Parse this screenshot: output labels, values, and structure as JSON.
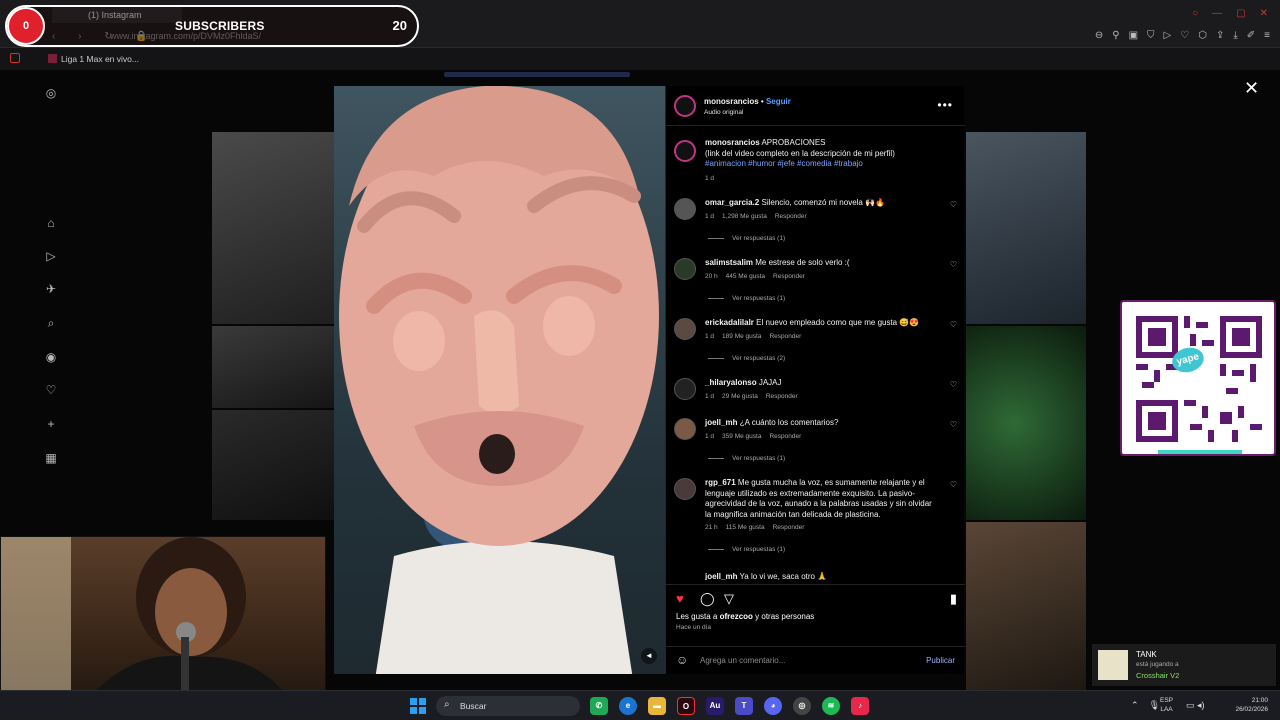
{
  "overlay": {
    "subscriber_label": "SUBSCRIBERS",
    "subscriber_count": "20",
    "circle_count": "0"
  },
  "browser": {
    "tab_title": "(1) Instagram",
    "url": "www.instagram.com/p/DVMz0FhldaS/",
    "bookmark_title": "Liga 1 Max en vivo..."
  },
  "post": {
    "author": "monosrancios",
    "separator": "•",
    "follow_label": "Seguir",
    "audio": "Audio original",
    "caption_title": "APROBACIONES",
    "caption_line2": "(link del video completo en la descripción de mi perfil)",
    "caption_tags": "#animacion #humor #jefe #comedia #trabajo",
    "caption_time": "1 d",
    "likes_text_prefix": "Les gusta a ",
    "likes_user": "ofrezcoo",
    "likes_text_suffix": " y otras personas",
    "posted": "Hace un día",
    "comment_placeholder": "Agrega un comentario...",
    "publish_label": "Publicar"
  },
  "comments": [
    {
      "user": "omar_garcia.2",
      "text": "Silencio, comenzó mi novela 🙌🏻🔥",
      "time": "1 d",
      "likes": "1,298 Me gusta",
      "reply": "Responder",
      "replies": "Ver respuestas (1)"
    },
    {
      "user": "salimstsalim",
      "text": "Me estrese de solo verlo :(",
      "time": "20 h",
      "likes": "445 Me gusta",
      "reply": "Responder",
      "replies": "Ver respuestas (1)"
    },
    {
      "user": "erickadalilalr",
      "text": "El nuevo empleado como que me gusta 😅😍",
      "time": "1 d",
      "likes": "189 Me gusta",
      "reply": "Responder",
      "replies": "Ver respuestas (2)"
    },
    {
      "user": "_hilaryalonso",
      "text": "JAJAJ",
      "time": "1 d",
      "likes": "29 Me gusta",
      "reply": "Responder",
      "replies": ""
    },
    {
      "user": "joell_mh",
      "text": "¿A cuánto los comentarios?",
      "time": "1 d",
      "likes": "359 Me gusta",
      "reply": "Responder",
      "replies": "Ver respuestas (1)"
    },
    {
      "user": "rgp_671",
      "text": "Me gusta mucha la voz, es sumamente relajante y el lenguaje utilizado es extremadamente exquisito. La pasivo-agrecividad de la voz, aunado a la palabras usadas y sin olvidar la magnifica animación tan delicada de plasticina.",
      "time": "21 h",
      "likes": "115 Me gusta",
      "reply": "Responder",
      "replies": "Ver respuestas (1)"
    },
    {
      "user": "joell_mh",
      "text": "Ya lo vi we, saca otro 🙏",
      "time": "",
      "likes": "",
      "reply": "",
      "replies": ""
    }
  ],
  "sidebar_icons": [
    "instagram-icon",
    "home-icon",
    "reels-icon",
    "messages-icon",
    "search-icon",
    "explore-icon",
    "heart-icon",
    "create-icon",
    "dashboard-icon"
  ],
  "qr": {
    "badge": "yape"
  },
  "notification": {
    "name": "TANK",
    "status": "está jugando a",
    "game": "Crosshair V2"
  },
  "taskbar": {
    "search_placeholder": "Buscar",
    "lang_1": "ESP",
    "lang_2": "LAA",
    "time": "21:00",
    "date": "26/02/2026"
  },
  "colors": {
    "accent_link": "#5aa0ff",
    "hashtag": "#7aa2ff",
    "like_red": "#ff3040",
    "subs_red": "#e0202a"
  }
}
